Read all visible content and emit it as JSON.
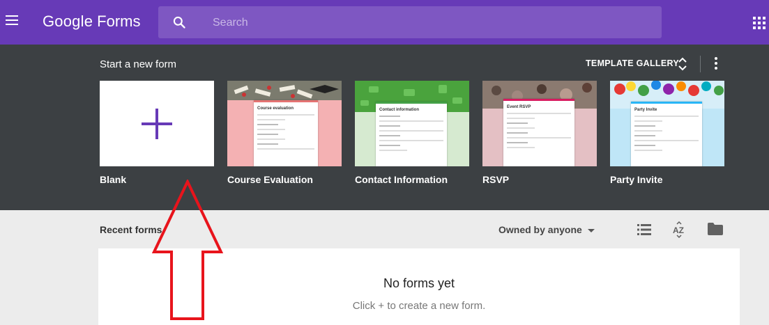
{
  "app": {
    "logo_google": "Google",
    "logo_product": "Forms"
  },
  "search": {
    "placeholder": "Search"
  },
  "templates": {
    "section_title": "Start a new form",
    "gallery_label": "TEMPLATE GALLERY",
    "items": [
      {
        "label": "Blank"
      },
      {
        "label": "Course Evaluation",
        "card_title": "Course evaluation"
      },
      {
        "label": "Contact Information",
        "card_title": "Contact information"
      },
      {
        "label": "RSVP",
        "card_title": "Event RSVP"
      },
      {
        "label": "Party Invite",
        "card_title": "Party Invite"
      }
    ]
  },
  "recent": {
    "title": "Recent forms",
    "owner_filter": "Owned by anyone",
    "empty_title": "No forms yet",
    "empty_subtitle": "Click + to create a new form."
  },
  "colors": {
    "brand": "#673ab7",
    "template_bg": "#3c4043",
    "plus": "#673ab7",
    "annotation_arrow": "#e8141c"
  },
  "icons": {
    "menu": "hamburger-icon",
    "search": "search-icon",
    "apps": "apps-grid-icon",
    "expand": "unfold-icon",
    "more": "more-vert-icon",
    "plus": "plus-icon",
    "list": "list-view-icon",
    "sort": "sort-az-icon",
    "folder": "folder-icon"
  }
}
